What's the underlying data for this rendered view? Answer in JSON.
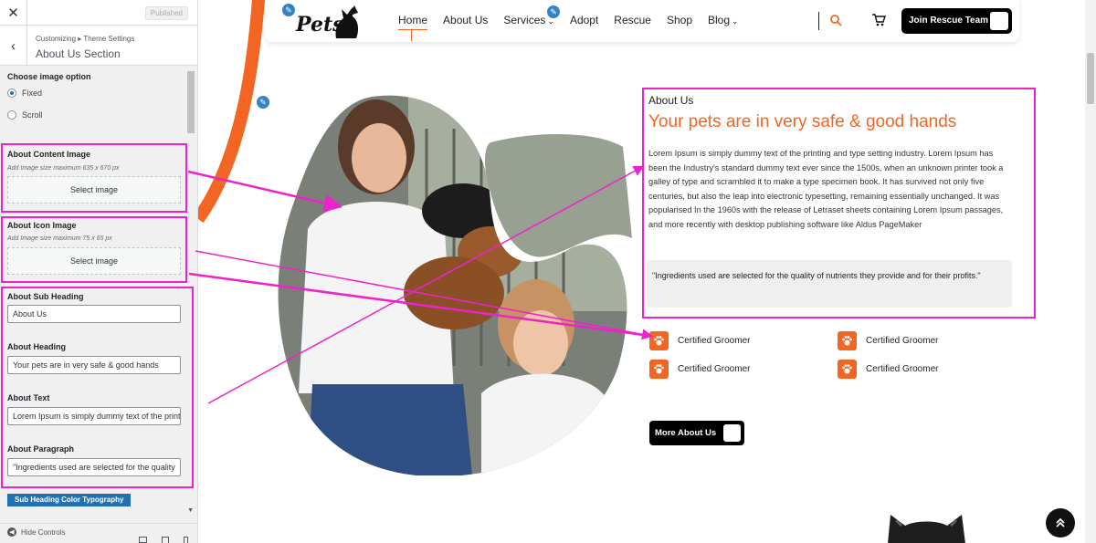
{
  "customizer": {
    "close_icon": "✕",
    "published_label": "Published",
    "back_icon": "‹",
    "breadcrumb": "Customizing ▸ Theme Settings",
    "section_title": "About Us Section",
    "image_option_label": "Choose image option",
    "radio_fixed": "Fixed",
    "radio_scroll": "Scroll",
    "selected_option": "Fixed",
    "content_image": {
      "label": "About Content Image",
      "hint": "Add Image size maximum 635 x 670 px",
      "button": "Select image"
    },
    "icon_image": {
      "label": "About Icon Image",
      "hint": "Add Image size maximum 75 x 65 px",
      "button": "Select image"
    },
    "sub_heading": {
      "label": "About Sub Heading",
      "value": "About Us"
    },
    "heading": {
      "label": "About Heading",
      "value": "Your pets are in very safe & good hands"
    },
    "text": {
      "label": "About Text",
      "value": "Lorem Ipsum is simply dummy text of the printing"
    },
    "paragraph": {
      "label": "About Paragraph",
      "value": "\"Ingredients used are selected for the quality"
    },
    "typography_button": "Sub Heading Color Typography",
    "hide_controls": "Hide Controls",
    "scroll_down_icon": "▼"
  },
  "site": {
    "logo_text": "Pets",
    "menu": [
      "Home",
      "About Us",
      "Services",
      "Adopt",
      "Rescue",
      "Shop",
      "Blog"
    ],
    "services_suffix": "⌄",
    "blog_suffix": "⌄",
    "active_menu": "Home",
    "join_button": "Join Rescue Team",
    "accent_color": "#f26522",
    "highlight_color": "#ee22cc"
  },
  "about": {
    "sub_heading": "About Us",
    "heading": "Your pets are in very safe & good hands",
    "text": "Lorem Ipsum is simply dummy text of the printing and type setting industry. Lorem Ipsum has been the Industry's standard dummy text ever since the 1500s, when an unknown printer took a galley of type and scrambled it to make a type specimen book. It has survived not only five centuries, but also the leap into electronic typesetting, remaining essentially unchanged. It was popularised In the 1960s with the release of Letraset sheets containing Lorem Ipsum passages, and more recently with desktop publishing software like Aldus PageMaker",
    "quote": "\"Ingredients used are selected for the quality of nutrients they provide and for their profits.\"",
    "features": [
      "Certified Groomer",
      "Certified Groomer",
      "Certified Groomer",
      "Certified Groomer"
    ],
    "more_button": "More About Us"
  },
  "icons": {
    "pencil": "✎",
    "to_top": "chevron-double-up-icon",
    "paw": "paw-icon",
    "search": "search-icon",
    "cart": "cart-icon"
  }
}
